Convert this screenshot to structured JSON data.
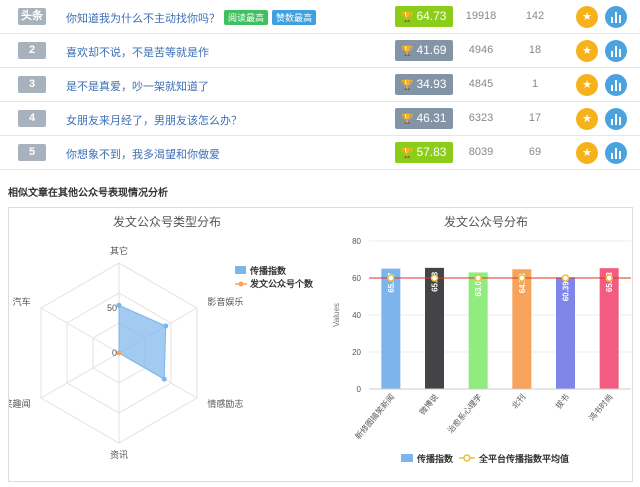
{
  "articles": [
    {
      "rank": "头条",
      "title": "你知道我为什么不主动找你吗？",
      "tags": [
        "阅读最高",
        "赞数最高"
      ],
      "score": "64.73",
      "reads": "19918",
      "likes": "142",
      "score_style": "green"
    },
    {
      "rank": "2",
      "title": "喜欢却不说，不是苦等就是作",
      "tags": [],
      "score": "41.69",
      "reads": "4946",
      "likes": "18",
      "score_style": "gray"
    },
    {
      "rank": "3",
      "title": "是不是真爱，吵一架就知道了",
      "tags": [],
      "score": "34.93",
      "reads": "4845",
      "likes": "1",
      "score_style": "gray"
    },
    {
      "rank": "4",
      "title": "女朋友来月经了，男朋友该怎么办？",
      "tags": [],
      "score": "46.31",
      "reads": "6323",
      "likes": "17",
      "score_style": "gray"
    },
    {
      "rank": "5",
      "title": "你想象不到，我多渴望和你做爱",
      "tags": [],
      "score": "57.83",
      "reads": "8039",
      "likes": "69",
      "score_style": "green"
    }
  ],
  "row_icons": {
    "star": "star-icon",
    "chart": "bar-chart-icon",
    "trophy": "trophy-icon"
  },
  "section_title": "相似文章在其他公众号表现情况分析",
  "colors": {
    "accent_blue": "#3d6fb5",
    "score_green": "#8ccc1a",
    "score_gray": "#8394a6",
    "star": "#f6b21a",
    "chart_btn": "#4aa3df"
  },
  "chart_data": [
    {
      "type": "radar",
      "title": "发文公众号类型分布",
      "axes": [
        "其它",
        "影音娱乐",
        "情感励志",
        "资讯",
        "搞笑趣闻",
        "汽车"
      ],
      "scale_labels": [
        "0",
        "50"
      ],
      "rmax": 100,
      "series": [
        {
          "name": "传播指数",
          "values": [
            53,
            60,
            58,
            0,
            0,
            0
          ],
          "color": "#7cb5ec"
        },
        {
          "name": "发文公众号个数",
          "values": [
            1,
            1,
            1,
            1,
            1,
            1
          ],
          "color": "#f4a460"
        }
      ]
    },
    {
      "type": "bar",
      "title": "发文公众号分布",
      "ylabel": "Values",
      "ylim": [
        0,
        80
      ],
      "yticks": [
        0,
        20,
        40,
        60,
        80
      ],
      "categories": [
        "新修图搞笑新闻",
        "微博说",
        "治愈系心理学",
        "北刊",
        "拔书",
        "鸿书时尚"
      ],
      "values": [
        65.07,
        65.48,
        63.01,
        64.73,
        60.39,
        65.33
      ],
      "value_labels": [
        "65.07",
        "65.48",
        "63.01",
        "64.73",
        "60.39",
        "65.33"
      ],
      "bar_colors": [
        "#7cb5ec",
        "#434348",
        "#90ed7d",
        "#f7a35c",
        "#8085e9",
        "#f15c80"
      ],
      "average": 60,
      "series": [
        {
          "name": "传播指数",
          "color": "#7cb5ec"
        },
        {
          "name": "全平台传播指数平均值",
          "color": "#e8c23a"
        }
      ]
    }
  ]
}
